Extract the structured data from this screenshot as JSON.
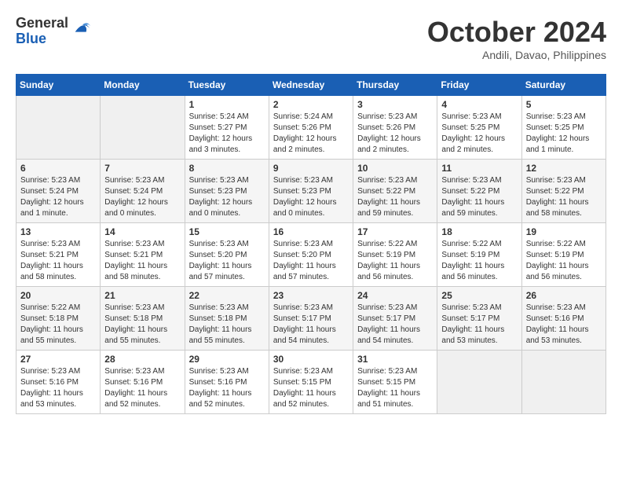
{
  "header": {
    "logo_general": "General",
    "logo_blue": "Blue",
    "month_title": "October 2024",
    "location": "Andili, Davao, Philippines"
  },
  "calendar": {
    "days_of_week": [
      "Sunday",
      "Monday",
      "Tuesday",
      "Wednesday",
      "Thursday",
      "Friday",
      "Saturday"
    ],
    "weeks": [
      [
        {
          "day": "",
          "sunrise": "",
          "sunset": "",
          "daylight": ""
        },
        {
          "day": "",
          "sunrise": "",
          "sunset": "",
          "daylight": ""
        },
        {
          "day": "1",
          "sunrise": "Sunrise: 5:24 AM",
          "sunset": "Sunset: 5:27 PM",
          "daylight": "Daylight: 12 hours and 3 minutes."
        },
        {
          "day": "2",
          "sunrise": "Sunrise: 5:24 AM",
          "sunset": "Sunset: 5:26 PM",
          "daylight": "Daylight: 12 hours and 2 minutes."
        },
        {
          "day": "3",
          "sunrise": "Sunrise: 5:23 AM",
          "sunset": "Sunset: 5:26 PM",
          "daylight": "Daylight: 12 hours and 2 minutes."
        },
        {
          "day": "4",
          "sunrise": "Sunrise: 5:23 AM",
          "sunset": "Sunset: 5:25 PM",
          "daylight": "Daylight: 12 hours and 2 minutes."
        },
        {
          "day": "5",
          "sunrise": "Sunrise: 5:23 AM",
          "sunset": "Sunset: 5:25 PM",
          "daylight": "Daylight: 12 hours and 1 minute."
        }
      ],
      [
        {
          "day": "6",
          "sunrise": "Sunrise: 5:23 AM",
          "sunset": "Sunset: 5:24 PM",
          "daylight": "Daylight: 12 hours and 1 minute."
        },
        {
          "day": "7",
          "sunrise": "Sunrise: 5:23 AM",
          "sunset": "Sunset: 5:24 PM",
          "daylight": "Daylight: 12 hours and 0 minutes."
        },
        {
          "day": "8",
          "sunrise": "Sunrise: 5:23 AM",
          "sunset": "Sunset: 5:23 PM",
          "daylight": "Daylight: 12 hours and 0 minutes."
        },
        {
          "day": "9",
          "sunrise": "Sunrise: 5:23 AM",
          "sunset": "Sunset: 5:23 PM",
          "daylight": "Daylight: 12 hours and 0 minutes."
        },
        {
          "day": "10",
          "sunrise": "Sunrise: 5:23 AM",
          "sunset": "Sunset: 5:22 PM",
          "daylight": "Daylight: 11 hours and 59 minutes."
        },
        {
          "day": "11",
          "sunrise": "Sunrise: 5:23 AM",
          "sunset": "Sunset: 5:22 PM",
          "daylight": "Daylight: 11 hours and 59 minutes."
        },
        {
          "day": "12",
          "sunrise": "Sunrise: 5:23 AM",
          "sunset": "Sunset: 5:22 PM",
          "daylight": "Daylight: 11 hours and 58 minutes."
        }
      ],
      [
        {
          "day": "13",
          "sunrise": "Sunrise: 5:23 AM",
          "sunset": "Sunset: 5:21 PM",
          "daylight": "Daylight: 11 hours and 58 minutes."
        },
        {
          "day": "14",
          "sunrise": "Sunrise: 5:23 AM",
          "sunset": "Sunset: 5:21 PM",
          "daylight": "Daylight: 11 hours and 58 minutes."
        },
        {
          "day": "15",
          "sunrise": "Sunrise: 5:23 AM",
          "sunset": "Sunset: 5:20 PM",
          "daylight": "Daylight: 11 hours and 57 minutes."
        },
        {
          "day": "16",
          "sunrise": "Sunrise: 5:23 AM",
          "sunset": "Sunset: 5:20 PM",
          "daylight": "Daylight: 11 hours and 57 minutes."
        },
        {
          "day": "17",
          "sunrise": "Sunrise: 5:22 AM",
          "sunset": "Sunset: 5:19 PM",
          "daylight": "Daylight: 11 hours and 56 minutes."
        },
        {
          "day": "18",
          "sunrise": "Sunrise: 5:22 AM",
          "sunset": "Sunset: 5:19 PM",
          "daylight": "Daylight: 11 hours and 56 minutes."
        },
        {
          "day": "19",
          "sunrise": "Sunrise: 5:22 AM",
          "sunset": "Sunset: 5:19 PM",
          "daylight": "Daylight: 11 hours and 56 minutes."
        }
      ],
      [
        {
          "day": "20",
          "sunrise": "Sunrise: 5:22 AM",
          "sunset": "Sunset: 5:18 PM",
          "daylight": "Daylight: 11 hours and 55 minutes."
        },
        {
          "day": "21",
          "sunrise": "Sunrise: 5:23 AM",
          "sunset": "Sunset: 5:18 PM",
          "daylight": "Daylight: 11 hours and 55 minutes."
        },
        {
          "day": "22",
          "sunrise": "Sunrise: 5:23 AM",
          "sunset": "Sunset: 5:18 PM",
          "daylight": "Daylight: 11 hours and 55 minutes."
        },
        {
          "day": "23",
          "sunrise": "Sunrise: 5:23 AM",
          "sunset": "Sunset: 5:17 PM",
          "daylight": "Daylight: 11 hours and 54 minutes."
        },
        {
          "day": "24",
          "sunrise": "Sunrise: 5:23 AM",
          "sunset": "Sunset: 5:17 PM",
          "daylight": "Daylight: 11 hours and 54 minutes."
        },
        {
          "day": "25",
          "sunrise": "Sunrise: 5:23 AM",
          "sunset": "Sunset: 5:17 PM",
          "daylight": "Daylight: 11 hours and 53 minutes."
        },
        {
          "day": "26",
          "sunrise": "Sunrise: 5:23 AM",
          "sunset": "Sunset: 5:16 PM",
          "daylight": "Daylight: 11 hours and 53 minutes."
        }
      ],
      [
        {
          "day": "27",
          "sunrise": "Sunrise: 5:23 AM",
          "sunset": "Sunset: 5:16 PM",
          "daylight": "Daylight: 11 hours and 53 minutes."
        },
        {
          "day": "28",
          "sunrise": "Sunrise: 5:23 AM",
          "sunset": "Sunset: 5:16 PM",
          "daylight": "Daylight: 11 hours and 52 minutes."
        },
        {
          "day": "29",
          "sunrise": "Sunrise: 5:23 AM",
          "sunset": "Sunset: 5:16 PM",
          "daylight": "Daylight: 11 hours and 52 minutes."
        },
        {
          "day": "30",
          "sunrise": "Sunrise: 5:23 AM",
          "sunset": "Sunset: 5:15 PM",
          "daylight": "Daylight: 11 hours and 52 minutes."
        },
        {
          "day": "31",
          "sunrise": "Sunrise: 5:23 AM",
          "sunset": "Sunset: 5:15 PM",
          "daylight": "Daylight: 11 hours and 51 minutes."
        },
        {
          "day": "",
          "sunrise": "",
          "sunset": "",
          "daylight": ""
        },
        {
          "day": "",
          "sunrise": "",
          "sunset": "",
          "daylight": ""
        }
      ]
    ]
  }
}
